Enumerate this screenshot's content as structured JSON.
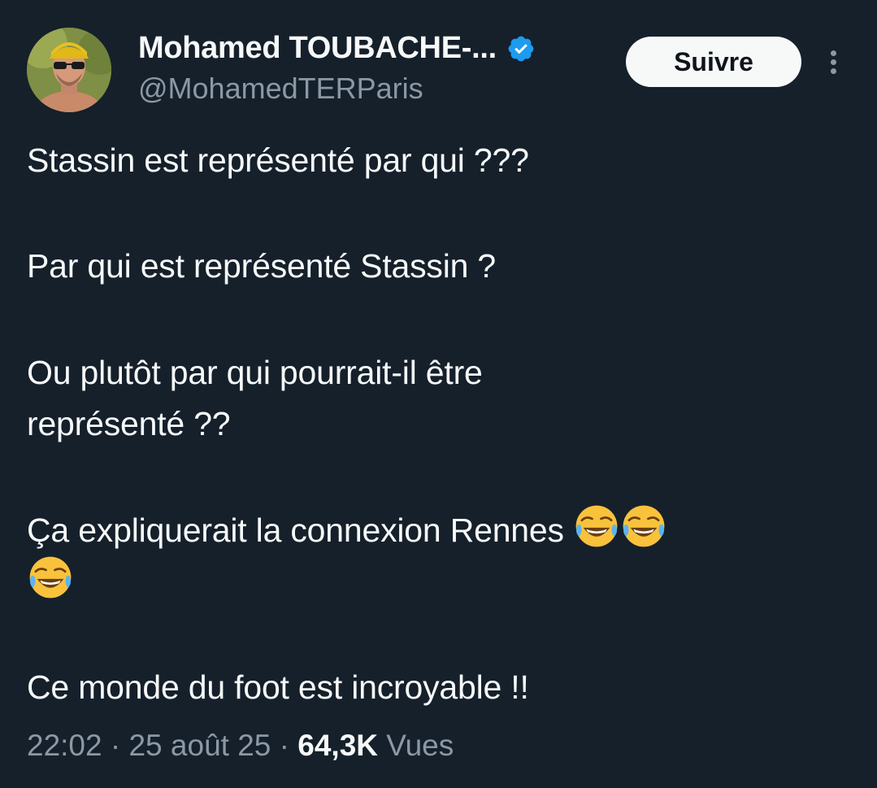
{
  "author": {
    "display_name": "Mohamed TOUBACHE-...",
    "handle": "@MohamedTERParis",
    "verified": true,
    "avatar_icon": "profile-photo"
  },
  "actions": {
    "follow_label": "Suivre",
    "more_icon": "more-vertical-icon"
  },
  "tweet": {
    "lines": [
      "Stassin est représenté par qui ???",
      "Par qui est représenté Stassin ?",
      "Ou plutôt par qui pourrait-il être",
      "représenté ??",
      "Ça expliquerait la connexion Rennes",
      "Ce monde du foot est incroyable !!"
    ],
    "emoji": "face-with-tears-of-joy",
    "emoji_count_line1": 2,
    "emoji_count_line2": 1
  },
  "meta": {
    "time": "22:02",
    "separator": "·",
    "date": "25 août 25",
    "views_count": "64,3K",
    "views_label": "Vues"
  },
  "colors": {
    "background": "#15202b",
    "text_primary": "#f7f9f9",
    "text_secondary": "#8b98a5",
    "verified_blue": "#1d9bf0",
    "button_bg": "#f7f9f9"
  }
}
